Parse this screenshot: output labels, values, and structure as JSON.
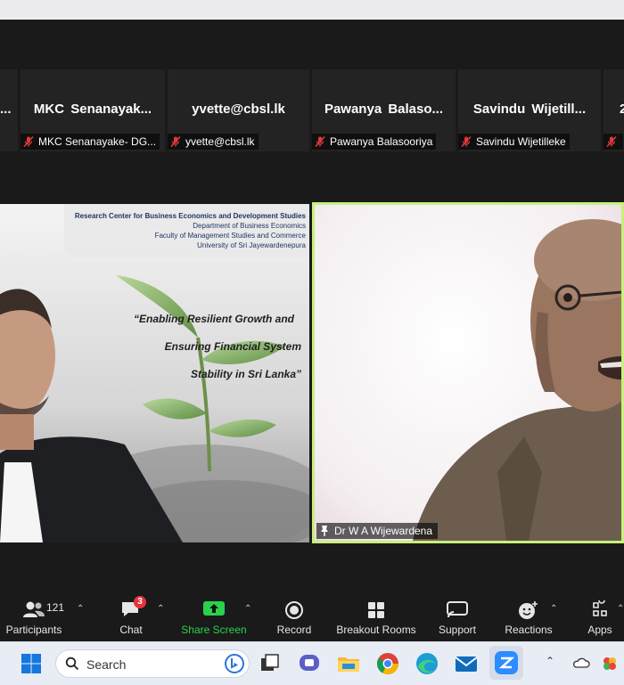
{
  "participants_strip": [
    {
      "big": "...",
      "tag": ""
    },
    {
      "big": "MKC Senanayak...",
      "tag": "MKC Senanayake- DG..."
    },
    {
      "big": "yvette@cbsl.lk",
      "tag": "yvette@cbsl.lk"
    },
    {
      "big": "Pawanya Balaso...",
      "tag": "Pawanya Balasooriya"
    },
    {
      "big": "Savindu Wijetill...",
      "tag": "Savindu Wijetilleke"
    },
    {
      "big": "2",
      "tag": ""
    }
  ],
  "slide": {
    "header": [
      "Research Center for Business Economics and Development Studies",
      "Department of Business Economics",
      "Faculty of Management Studies and Commerce",
      "University of Sri Jayewardenepura"
    ],
    "title_lines": [
      "“Enabling Resilient Growth and",
      "Ensuring Financial System",
      "Stability in Sri Lanka”"
    ]
  },
  "speaker": {
    "name": "Dr W A Wijewardena"
  },
  "toolbar": {
    "participants_label": "Participants",
    "participants_count": "121",
    "chat_label": "Chat",
    "chat_badge": "3",
    "share_label": "Share Screen",
    "record_label": "Record",
    "breakout_label": "Breakout Rooms",
    "support_label": "Support",
    "reactions_label": "Reactions",
    "apps_label": "Apps"
  },
  "taskbar": {
    "search_placeholder": "Search"
  },
  "colors": {
    "share_green": "#2bd14b",
    "speaker_border": "#c8f07a",
    "muted_red": "#e03a3a",
    "badge_red": "#e5333a"
  }
}
